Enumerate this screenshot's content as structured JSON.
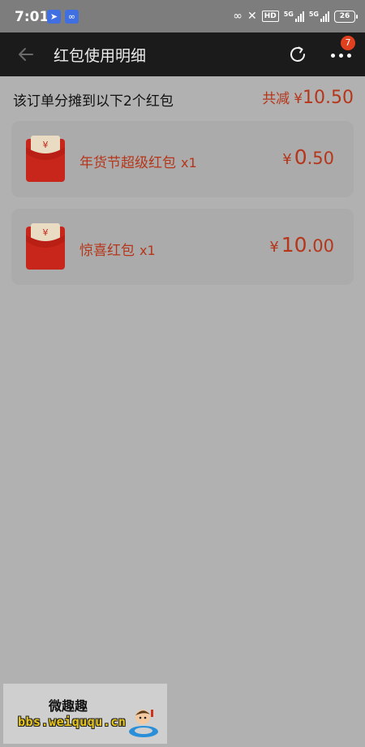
{
  "status_bar": {
    "time": "7:01",
    "network_1": "5G",
    "network_2": "5G",
    "hd": "HD",
    "battery": "26",
    "icons": [
      "location-app-icon",
      "link-app-icon",
      "link-icon",
      "mute-icon",
      "signal-icon",
      "battery-icon"
    ]
  },
  "nav": {
    "title": "红包使用明细",
    "badge_count": "7"
  },
  "summary": {
    "text": "该订单分摊到以下2个红包",
    "total_label": "共减",
    "currency": "¥",
    "total_amount": "10.50"
  },
  "red_packets": [
    {
      "name": "年货节超级红包",
      "qty": "x1",
      "currency": "¥",
      "amount_int": "0",
      "amount_dec": ".50"
    },
    {
      "name": "惊喜红包",
      "qty": "x1",
      "currency": "¥",
      "amount_int": "10",
      "amount_dec": ".00"
    }
  ],
  "watermark": {
    "title": "微趣趣",
    "url": "bbs.weiququ.cn"
  },
  "colors": {
    "accent": "#b5361a",
    "nav_bg": "#1b1b1b",
    "page_bg": "#b1b1b1",
    "badge": "#e1401f"
  }
}
